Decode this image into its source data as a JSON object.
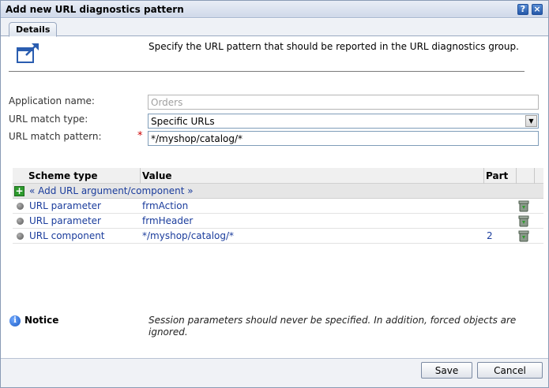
{
  "window": {
    "title": "Add new URL diagnostics pattern",
    "help_glyph": "?",
    "close_glyph": "×"
  },
  "tabs": [
    {
      "label": "Details",
      "selected": true
    }
  ],
  "intro": {
    "icon": "new-window-icon",
    "text": "Specify the URL pattern that should be reported in the URL diagnostics group."
  },
  "form": {
    "application_name": {
      "label": "Application name:",
      "value": "Orders",
      "disabled": true
    },
    "url_match_type": {
      "label": "URL match type:",
      "selected": "Specific URLs"
    },
    "url_match_pattern": {
      "label": "URL match pattern:",
      "required_mark": "*",
      "value": "*/myshop/catalog/*"
    }
  },
  "grid": {
    "columns": [
      "Scheme type",
      "Value",
      "Part"
    ],
    "add_label": "« Add URL argument/component »",
    "rows": [
      {
        "scheme": "URL parameter",
        "value": "frmAction",
        "part": ""
      },
      {
        "scheme": "URL parameter",
        "value": "frmHeader",
        "part": ""
      },
      {
        "scheme": "URL component",
        "value": "*/myshop/catalog/*",
        "part": "2"
      }
    ]
  },
  "notice": {
    "label": "Notice",
    "text": "Session parameters should never be specified. In addition, forced objects are ignored."
  },
  "buttons": {
    "save": "Save",
    "cancel": "Cancel"
  },
  "colors": {
    "link": "#1a3c9c",
    "required": "#cc0000",
    "add_icon": "#2e9b2e",
    "info_icon": "#1b5bc4"
  }
}
